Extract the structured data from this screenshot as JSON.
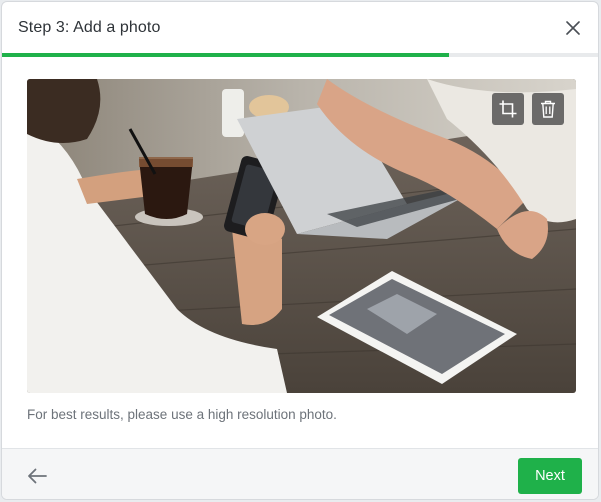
{
  "dialog": {
    "title": "Step 3: Add a photo",
    "close_icon": "close-icon",
    "progress_fraction": 0.75,
    "accent_color": "#1fb14a"
  },
  "photo": {
    "subject": "people at cafe table with laptop, phone, tablet and coffee",
    "tools": [
      {
        "name": "crop",
        "icon": "crop-icon"
      },
      {
        "name": "delete",
        "icon": "trash-icon"
      }
    ]
  },
  "hint": "For best results, please use a high resolution photo.",
  "footer": {
    "back_icon": "arrow-left-icon",
    "next_label": "Next"
  }
}
